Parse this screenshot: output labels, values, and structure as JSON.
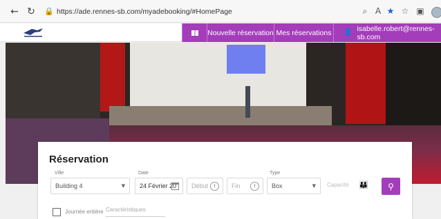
{
  "browser": {
    "back_icon": "back-arrow-icon",
    "reload_icon": "reload-icon",
    "url": "https://ade.rennes-sb.com/myadebooking/#HomePage"
  },
  "header": {
    "nav_new": "Nouvelle réservation",
    "nav_mine": "Mes réservations",
    "user_email": "isabelle.robert@rennes-sb.com",
    "accent": "#a43dba"
  },
  "reservation": {
    "title": "Réservation",
    "labels": {
      "ville": "Ville",
      "date": "Date",
      "type": "Type"
    },
    "ville_value": "Building 4",
    "date_value": "24 Février 20",
    "debut_placeholder": "Début",
    "fin_placeholder": "Fin",
    "type_value": "Box",
    "capacite_placeholder": "Capacité",
    "journee_label": "Journée entière",
    "caracteristiques_placeholder": "Caractéristiques"
  }
}
